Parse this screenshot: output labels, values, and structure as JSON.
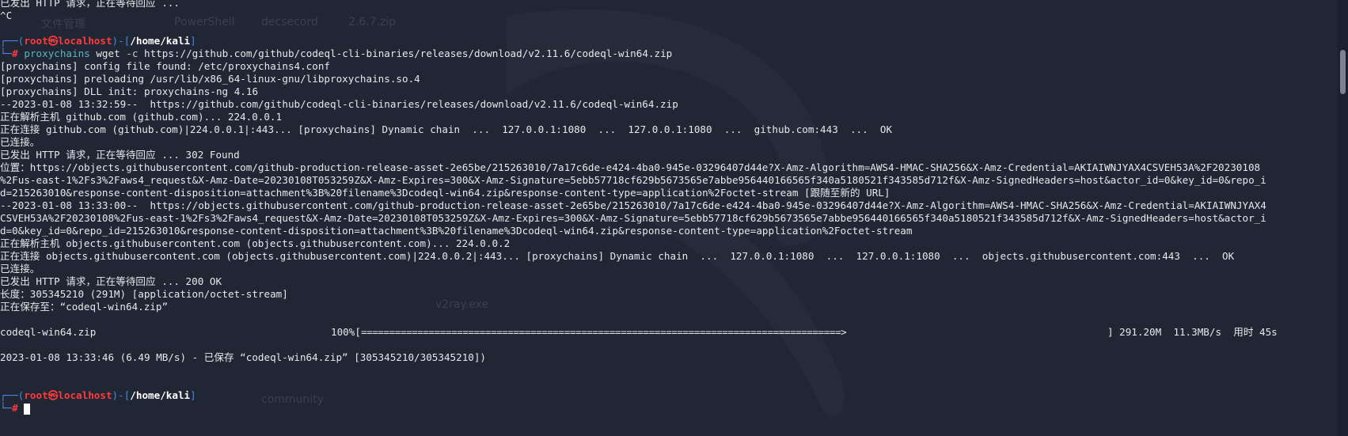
{
  "terminal": {
    "lines": [
      "已发出 HTTP 请求，正在等待回应 ...",
      "^C",
      "",
      null,
      null,
      "[proxychains] config file found: /etc/proxychains4.conf",
      "[proxychains] preloading /usr/lib/x86_64-linux-gnu/libproxychains.so.4",
      "[proxychains] DLL init: proxychains-ng 4.16",
      "--2023-01-08 13:32:59--  https://github.com/github/codeql-cli-binaries/releases/download/v2.11.6/codeql-win64.zip",
      "正在解析主机 github.com (github.com)... 224.0.0.1",
      "正在连接 github.com (github.com)|224.0.0.1|:443... [proxychains] Dynamic chain  ...  127.0.0.1:1080  ...  127.0.0.1:1080  ...  github.com:443  ...  OK",
      "已连接。",
      "已发出 HTTP 请求，正在等待回应 ... 302 Found",
      "位置：https://objects.githubusercontent.com/github-production-release-asset-2e65be/215263010/7a17c6de-e424-4ba0-945e-03296407d44e?X-Amz-Algorithm=AWS4-HMAC-SHA256&X-Amz-Credential=AKIAIWNJYAX4CSVEH53A%2F20230108",
      "%2Fus-east-1%2Fs3%2Faws4_request&X-Amz-Date=20230108T053259Z&X-Amz-Expires=300&X-Amz-Signature=5ebb57718cf629b5673565e7abbe956440166565f340a5180521f343585d712f&X-Amz-SignedHeaders=host&actor_id=0&key_id=0&repo_i",
      "d=215263010&response-content-disposition=attachment%3B%20filename%3Dcodeql-win64.zip&response-content-type=application%2Foctet-stream [跟随至新的 URL]",
      "--2023-01-08 13:33:00--  https://objects.githubusercontent.com/github-production-release-asset-2e65be/215263010/7a17c6de-e424-4ba0-945e-03296407d44e?X-Amz-Algorithm=AWS4-HMAC-SHA256&X-Amz-Credential=AKIAIWNJYAX4",
      "CSVEH53A%2F20230108%2Fus-east-1%2Fs3%2Faws4_request&X-Amz-Date=20230108T053259Z&X-Amz-Expires=300&X-Amz-Signature=5ebb57718cf629b5673565e7abbe956440166565f340a5180521f343585d712f&X-Amz-SignedHeaders=host&actor_i",
      "d=0&key_id=0&repo_id=215263010&response-content-disposition=attachment%3B%20filename%3Dcodeql-win64.zip&response-content-type=application%2Foctet-stream",
      "正在解析主机 objects.githubusercontent.com (objects.githubusercontent.com)... 224.0.0.2",
      "正在连接 objects.githubusercontent.com (objects.githubusercontent.com)|224.0.0.2|:443... [proxychains] Dynamic chain  ...  127.0.0.1:1080  ...  127.0.0.1:1080  ...  objects.githubusercontent.com:443  ...  OK",
      "已连接。",
      "已发出 HTTP 请求，正在等待回应 ... 200 OK",
      "长度：305345210 (291M) [application/octet-stream]",
      "正在保存至：“codeql-win64.zip”",
      "",
      null,
      "",
      "2023-01-08 13:33:46 (6.49 MB/s) - 已保存 “codeql-win64.zip” [305345210/305345210])",
      "",
      "",
      null,
      null
    ],
    "prompt": {
      "top_left": "┌──(",
      "user": "root",
      "at_symbol": "㉿",
      "host": "localhost",
      "mid": ")-[",
      "path": "/home/kali",
      "close": "]",
      "bottom_left": "└─",
      "hash": "#"
    },
    "command": {
      "tool": "proxychains",
      "rest_before_flag": " wget ",
      "flag": "-c",
      "url": " https://github.com/github/codeql-cli-binaries/releases/download/v2.11.6/codeql-win64.zip"
    },
    "progress": {
      "filename": "codeql-win64.zip",
      "percent": "100%",
      "percent_value": 100,
      "bar_open": "[",
      "bar_fill": "=====================================================================================>",
      "bar_close": "]",
      "size": "291.20M",
      "speed": "11.3MB/s",
      "time_label": "用时",
      "time": "45s"
    }
  },
  "wallpaper": {
    "labels": [
      "文件管理",
      "PowerShell",
      "decsecord",
      "2.6.7.zip",
      "v2ray.exe",
      "community"
    ]
  },
  "colors": {
    "background": "#212634",
    "prompt_frame": "#4a86e8",
    "user_host": "#ff3b3b",
    "command_tool": "#56b6c2"
  }
}
